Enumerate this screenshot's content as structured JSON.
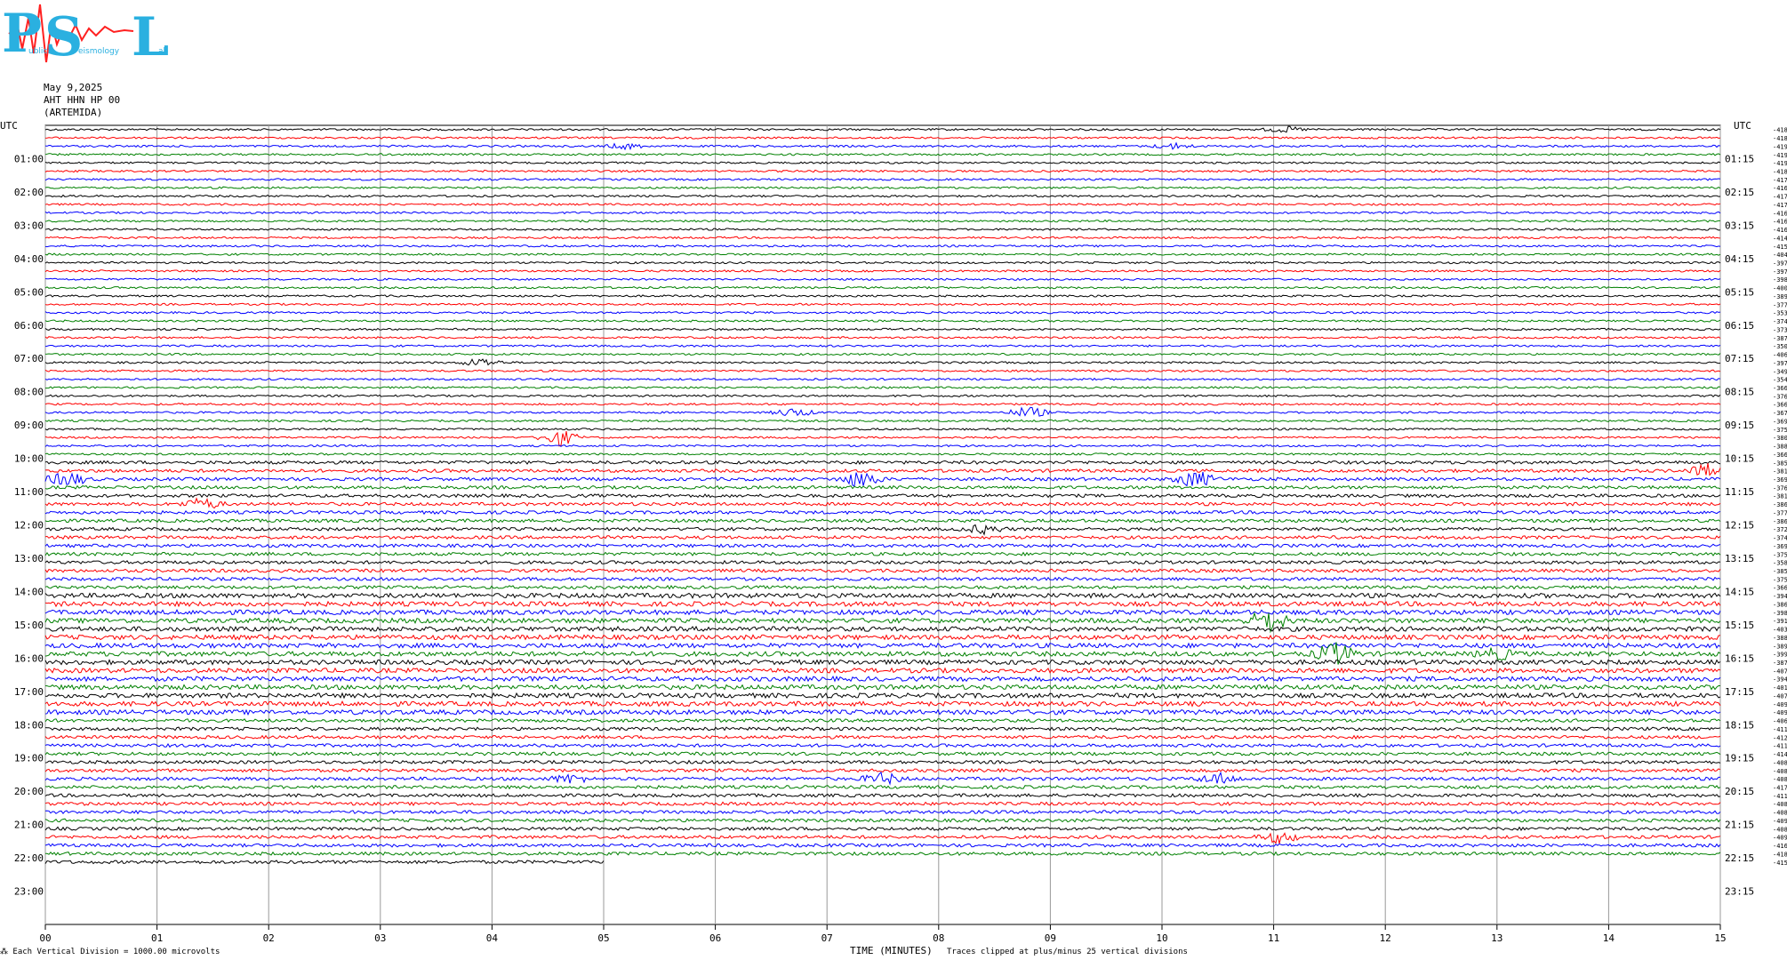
{
  "logo": {
    "letters": [
      "P",
      "S",
      "L"
    ],
    "small_text": [
      "ublic",
      "eismology",
      "ab"
    ]
  },
  "header": {
    "date": "May 9,2025",
    "station": "AHT HHN HP 00",
    "location": "(ARTEMIDA)"
  },
  "footer": {
    "scale_note": "Each Vertical Division = 1000.00 microvolts",
    "xaxis_title": "TIME (MINUTES)",
    "clip_note": "Traces clipped at plus/minus 25 vertical divisions"
  },
  "chart_data": {
    "type": "line",
    "xlabel": "TIME (MINUTES)",
    "xlim": [
      0,
      15
    ],
    "x_ticks": [
      "00",
      "01",
      "02",
      "03",
      "04",
      "05",
      "06",
      "07",
      "08",
      "09",
      "10",
      "11",
      "12",
      "13",
      "14",
      "15"
    ],
    "left_axis_title": "UTC",
    "right_axis_title": "UTC",
    "left_labels": [
      "01:00",
      "02:00",
      "03:00",
      "04:00",
      "05:00",
      "06:00",
      "07:00",
      "08:00",
      "09:00",
      "10:00",
      "11:00",
      "12:00",
      "13:00",
      "14:00",
      "15:00",
      "16:00",
      "17:00",
      "18:00",
      "19:00",
      "20:00",
      "21:00",
      "22:00",
      "23:00"
    ],
    "right_labels": [
      "01:15",
      "02:15",
      "03:15",
      "04:15",
      "05:15",
      "06:15",
      "07:15",
      "08:15",
      "09:15",
      "10:15",
      "11:15",
      "12:15",
      "13:15",
      "14:15",
      "15:15",
      "16:15",
      "17:15",
      "18:15",
      "19:15",
      "20:15",
      "21:15",
      "22:15",
      "23:15"
    ],
    "trace_colors": [
      "#000000",
      "#ff0000",
      "#0000ff",
      "#008000"
    ],
    "traces_per_hour": 4,
    "last_trace_end_minute": 5,
    "trace_offsets": [
      -4180,
      -4182,
      -4195,
      -4192,
      -4195,
      -4183,
      -4178,
      -4167,
      -4174,
      -4178,
      -4169,
      -4164,
      -4169,
      -4147,
      -4155,
      -4045,
      -3974,
      -3976,
      -3986,
      -4009,
      -3892,
      -3776,
      -3535,
      -3745,
      -3733,
      -3873,
      -3504,
      -4060,
      -3971,
      -3492,
      -3543,
      -3663,
      -3762,
      -3669,
      -3676,
      -3699,
      -3759,
      -3808,
      -3885,
      -3662,
      -3858,
      -3818,
      -3697,
      -3764,
      -3811,
      -3869,
      -3779,
      -3867,
      -3726,
      -3742,
      -3699,
      -3754,
      -3583,
      -3858,
      -3753,
      -3662,
      -3943,
      -3863,
      -3989,
      -3917,
      -4031,
      -3888,
      -3897,
      -3996,
      -3873,
      -4077,
      -3944,
      -4012,
      -4078,
      -4093,
      -4094,
      -4069,
      -4111,
      -4122,
      -4118,
      -4142,
      -4080,
      -4080,
      -4085,
      -4172,
      -4118,
      -4080,
      -4087,
      -4098,
      -4086,
      -4097,
      -4163,
      -4185,
      -4158
    ],
    "events": [
      {
        "trace": 0,
        "minute": 11.1,
        "amp": 1.0
      },
      {
        "trace": 2,
        "minute": 5.2,
        "amp": 1.0
      },
      {
        "trace": 2,
        "minute": 10.1,
        "amp": 1.0
      },
      {
        "trace": 28,
        "minute": 3.9,
        "amp": 1.5
      },
      {
        "trace": 34,
        "minute": 6.7,
        "amp": 1.5
      },
      {
        "trace": 34,
        "minute": 8.8,
        "amp": 2.0
      },
      {
        "trace": 37,
        "minute": 4.6,
        "amp": 3.0
      },
      {
        "trace": 41,
        "minute": 14.9,
        "amp": 2.5
      },
      {
        "trace": 42,
        "minute": 0.2,
        "amp": 2.5
      },
      {
        "trace": 42,
        "minute": 7.3,
        "amp": 3.0
      },
      {
        "trace": 42,
        "minute": 10.3,
        "amp": 3.0
      },
      {
        "trace": 45,
        "minute": 1.4,
        "amp": 2.0
      },
      {
        "trace": 48,
        "minute": 8.4,
        "amp": 1.5
      },
      {
        "trace": 59,
        "minute": 10.95,
        "amp": 4.0
      },
      {
        "trace": 63,
        "minute": 11.55,
        "amp": 4.0
      },
      {
        "trace": 63,
        "minute": 13.0,
        "amp": 2.0
      },
      {
        "trace": 78,
        "minute": 4.7,
        "amp": 1.5
      },
      {
        "trace": 78,
        "minute": 7.5,
        "amp": 2.0
      },
      {
        "trace": 78,
        "minute": 10.5,
        "amp": 2.0
      },
      {
        "trace": 85,
        "minute": 11.05,
        "amp": 2.0
      }
    ]
  }
}
